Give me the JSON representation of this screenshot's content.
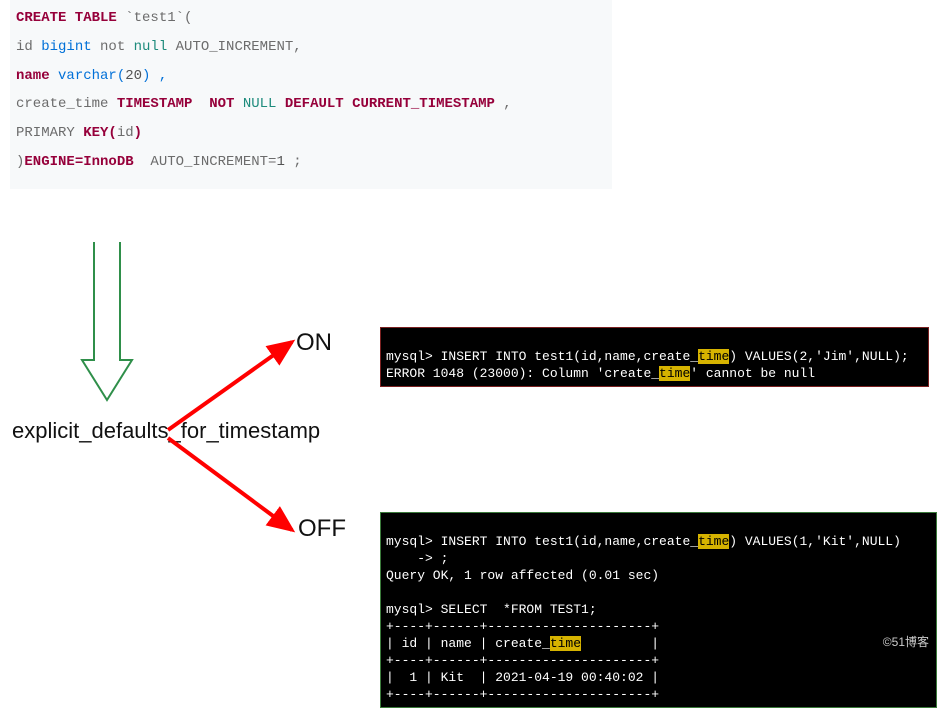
{
  "code": {
    "l1": {
      "a": "CREATE TABLE",
      "b": " `test1`("
    },
    "l2": {
      "a": "id",
      "b": " bigint",
      "c": " not",
      "d": " null",
      "e": " AUTO_INCREMENT,"
    },
    "l3": {
      "a": "name",
      "b": " varchar(",
      "c": "20",
      "d": ") ,"
    },
    "l4": {
      "a": "create_time ",
      "b": "TIMESTAMP  NOT",
      "c": " NULL",
      "d": " DEFAULT CURRENT_TIMESTAMP",
      "e": " ,"
    },
    "l5": {
      "a": "PRIMARY",
      "b": " KEY(",
      "c": "id",
      "d": ")"
    },
    "l6": {
      "a": ")",
      "b": "ENGINE=InnoDB",
      "c": "  AUTO_INCREMENT=",
      "d": "1",
      "e": " ;"
    }
  },
  "var_label": "explicit_defaults_for_timestamp",
  "toggle": {
    "on": "ON",
    "off": "OFF"
  },
  "term_on": {
    "l1a": "mysql> INSERT INTO test1(id,name,create_",
    "l1hl": "time",
    "l1b": ") VALUES(2,'Jim',NULL);",
    "l2a": "ERROR 1048 (23000): Column 'create_",
    "l2hl": "time",
    "l2b": "' cannot be null"
  },
  "term_off": {
    "l1a": "mysql> INSERT INTO test1(id,name,create_",
    "l1hl": "time",
    "l1b": ") VALUES(1,'Kit',NULL)",
    "l2": "    -> ;",
    "l3": "Query OK, 1 row affected (0.01 sec)",
    "blank": " ",
    "l4": "mysql> SELECT  *FROM TEST1;",
    "sep": "+----+------+---------------------+",
    "h1a": "| id | name | create_",
    "h1hl": "time",
    "h1b": "         |",
    "row": "|  1 | Kit  | 2021-04-19 00:40:02 |"
  },
  "watermark": "©51博客"
}
